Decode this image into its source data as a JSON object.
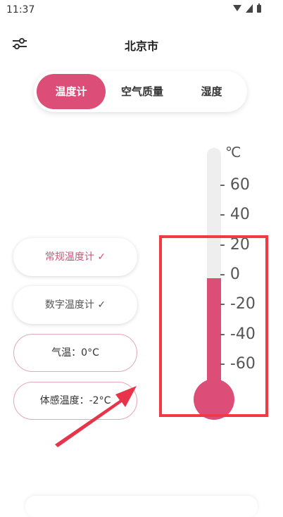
{
  "status_bar": {
    "time": "11:37",
    "icons": [
      "wifi-icon",
      "signal-icon",
      "battery-icon"
    ]
  },
  "header": {
    "title": "北京市",
    "filter_icon": "sliders-icon"
  },
  "tabs": [
    {
      "label": "温度计",
      "active": true
    },
    {
      "label": "空气质量",
      "active": false
    },
    {
      "label": "湿度",
      "active": false
    }
  ],
  "modes": {
    "regular": "常规温度计 ✓",
    "digital": "数字温度计 ✓",
    "temperature": "气温：0°C",
    "feels_like": "体感温度：-2°C"
  },
  "thermometer": {
    "unit": "℃",
    "ticks": [
      "- 60",
      "- 40",
      "- 20",
      "- 0",
      "- -20",
      "- -40",
      "- -60"
    ],
    "level_percent": 50
  },
  "colors": {
    "accent": "#dc4d78",
    "highlight": "#f13a44",
    "arrow": "#e8344a"
  }
}
